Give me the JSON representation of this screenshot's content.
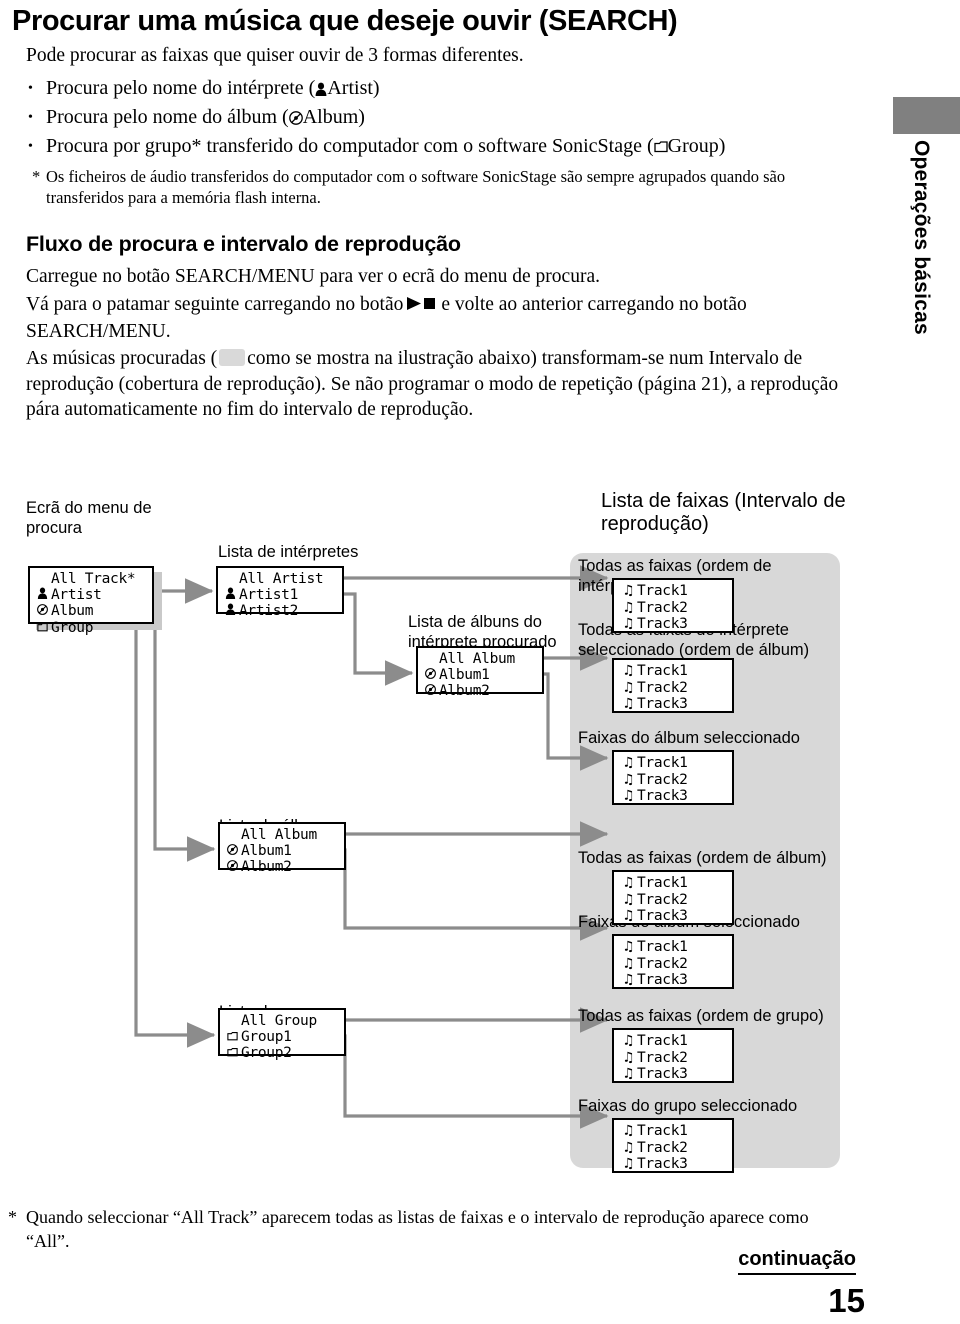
{
  "header": {
    "title": "Procurar uma música que deseje ouvir (SEARCH)",
    "intro": "Pode procurar as faixas que quiser ouvir de 3 formas diferentes.",
    "bullets": [
      "Procura pelo nome do intérprete (⬤Artist)",
      "Procura pelo nome do álbum (⬤Album)",
      "Procura por grupo* transferido do computador com o software SonicStage (⬤Group)"
    ],
    "bullet_parts": [
      {
        "pre": "Procura pelo nome do intérprete (",
        "icon": "person-icon",
        "word": "Artist",
        "post": ")"
      },
      {
        "pre": "Procura pelo nome do álbum (",
        "icon": "disc-icon",
        "word": "Album",
        "post": ")"
      },
      {
        "pre": "Procura por grupo* transferido do computador com o software SonicStage (",
        "icon": "folder-icon",
        "word": "Group",
        "post": ")"
      }
    ],
    "footnote": "Os ficheiros de áudio transferidos do computador com o software SonicStage são sempre agrupados quando são transferidos para a memória flash interna.",
    "footnote_star": "*"
  },
  "section": {
    "heading": "Fluxo de procura e intervalo de reprodução",
    "para1": "Carregue no botão SEARCH/MENU para ver o ecrã do menu de procura.",
    "para2_a": "Vá para o patamar seguinte carregando no botão",
    "para2_b": "e volte ao anterior carregando no botão SEARCH/MENU.",
    "para3_a": "As músicas procuradas (",
    "para3_b": "como se mostra na ilustração abaixo) transformam-se num Intervalo de reprodução (cobertura de reprodução). Se não programar o modo de repetição (página 21), a reprodução pára automaticamente no fim do intervalo de reprodução."
  },
  "side_tab": {
    "label": "Operações básicas",
    "bar_color": "#808080"
  },
  "diagram": {
    "labels": {
      "search_menu": "Ecrã do menu de\nprocura",
      "artist_list": "Lista de intérpretes",
      "album_list_of_artist": "Lista de álbuns do\nintérprete procurado",
      "album_list": "Lista de álbuns",
      "group_list": "Lista de grupos",
      "track_list_title": "Lista de faixas (Intervalo de\nreprodução)",
      "g1": "Todas as faixas (ordem de intérprete)",
      "g2": "Todas as faixas do intérprete\nseleccionado (ordem de álbum)",
      "g3": "Faixas do álbum seleccionado",
      "g4": "Todas as faixas (ordem de álbum)",
      "g5": "Faixas do álbum seleccionado",
      "g6": "Todas as faixas (ordem de grupo)",
      "g7": "Faixas do grupo seleccionado"
    },
    "screens": {
      "menu": {
        "title": "All Track*",
        "items": [
          {
            "icon": "person-icon",
            "label": "Artist"
          },
          {
            "icon": "disc-icon",
            "label": "Album"
          },
          {
            "icon": "folder-icon",
            "label": "Group"
          }
        ]
      },
      "artist": {
        "title": "All Artist",
        "items": [
          {
            "icon": "person-icon",
            "label": "Artist1"
          },
          {
            "icon": "person-icon",
            "label": "Artist2"
          }
        ]
      },
      "album_of_artist": {
        "title": "All Album",
        "items": [
          {
            "icon": "disc-icon",
            "label": "Album1"
          },
          {
            "icon": "disc-icon",
            "label": "Album2"
          }
        ]
      },
      "album": {
        "title": "All Album",
        "items": [
          {
            "icon": "disc-icon",
            "label": "Album1"
          },
          {
            "icon": "disc-icon",
            "label": "Album2"
          }
        ]
      },
      "group": {
        "title": "All Group",
        "items": [
          {
            "icon": "folder-icon",
            "label": "Group1"
          },
          {
            "icon": "folder-icon",
            "label": "Group2"
          }
        ]
      }
    },
    "track_rows": [
      {
        "icon": "note-icon",
        "label": "Track1"
      },
      {
        "icon": "note-icon",
        "label": "Track2"
      },
      {
        "icon": "note-icon",
        "label": "Track3"
      }
    ],
    "panel_color": "#d8d8d8",
    "wire_color": "#8c8c8c"
  },
  "bottom": {
    "note_star": "*",
    "note": "Quando seleccionar “All Track” aparecem todas as listas de faixas e o intervalo de reprodução aparece como “All”.",
    "continuation": "continuação",
    "page": "15"
  }
}
